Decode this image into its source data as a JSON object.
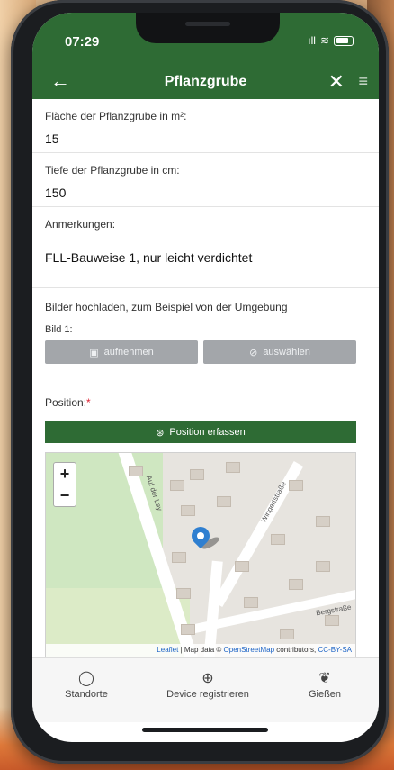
{
  "status": {
    "time": "07:29",
    "signal": "ıll",
    "wifi": "≋"
  },
  "appbar": {
    "back_icon": "←",
    "title": "Pflanzgrube",
    "close_icon": "✕",
    "menu_icon": "≡"
  },
  "form": {
    "area": {
      "label": "Fläche der Pflanzgrube in m²:",
      "value": "15"
    },
    "depth": {
      "label": "Tiefe der Pflanzgrube in cm:",
      "value": "150"
    },
    "notes": {
      "label": "Anmerkungen:",
      "value": "FLL-Bauweise 1, nur leicht verdichtet"
    },
    "images": {
      "label": "Bilder hochladen, zum Beispiel von der Umgebung",
      "image1_label": "Bild 1:",
      "capture_button": "aufnehmen",
      "choose_button": "auswählen"
    },
    "position": {
      "label": "Position:",
      "required_mark": "*",
      "button": "Position erfassen"
    }
  },
  "map": {
    "zoom_in": "+",
    "zoom_out": "−",
    "street_1": "Auf der Lay",
    "street_2": "Wingertstraße",
    "street_3": "Bergstraße",
    "attr_leaflet": "Leaflet",
    "attr_mapdata": " | Map data © ",
    "attr_osm": "OpenStreetMap",
    "attr_contrib": " contributors, ",
    "attr_license": "CC-BY-SA"
  },
  "tabs": [
    {
      "label": "Standorte",
      "icon": "◯"
    },
    {
      "label": "Device registrieren",
      "icon": "⊕"
    },
    {
      "label": "Gießen",
      "icon": "❦"
    }
  ],
  "colors": {
    "primary": "#2e6b34",
    "button_grey": "#a3a6aa",
    "pin": "#2f7fd0"
  }
}
